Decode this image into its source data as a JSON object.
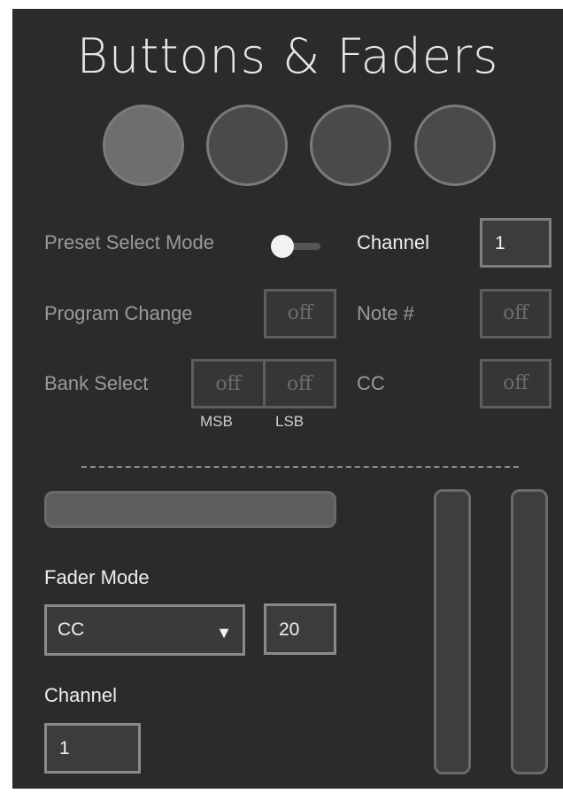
{
  "title": "Buttons & Faders",
  "pads": [
    {
      "name": "pad-1",
      "active": true
    },
    {
      "name": "pad-2",
      "active": false
    },
    {
      "name": "pad-3",
      "active": false
    },
    {
      "name": "pad-4",
      "active": false
    }
  ],
  "preset": {
    "mode_label": "Preset Select Mode",
    "mode_toggle_on": false,
    "program_change_label": "Program Change",
    "program_change_value": "off",
    "bank_select_label": "Bank Select",
    "msb_value": "off",
    "lsb_value": "off",
    "msb_label": "MSB",
    "lsb_label": "LSB"
  },
  "channel_section": {
    "channel_label": "Channel",
    "channel_value": "1",
    "note_label": "Note #",
    "note_value": "off",
    "cc_label": "CC",
    "cc_value": "off"
  },
  "fader": {
    "mode_label": "Fader Mode",
    "mode_selected": "CC",
    "mode_arrow": "▼",
    "cc_number": "20",
    "channel_label": "Channel",
    "channel_value": "1"
  },
  "colors": {
    "panel_bg": "#2b2b2b",
    "pad_active": "#6e6e6e",
    "pad_inactive": "#4a4a4a",
    "dim_text": "#9a9a9a",
    "bright_text": "#ededed"
  }
}
